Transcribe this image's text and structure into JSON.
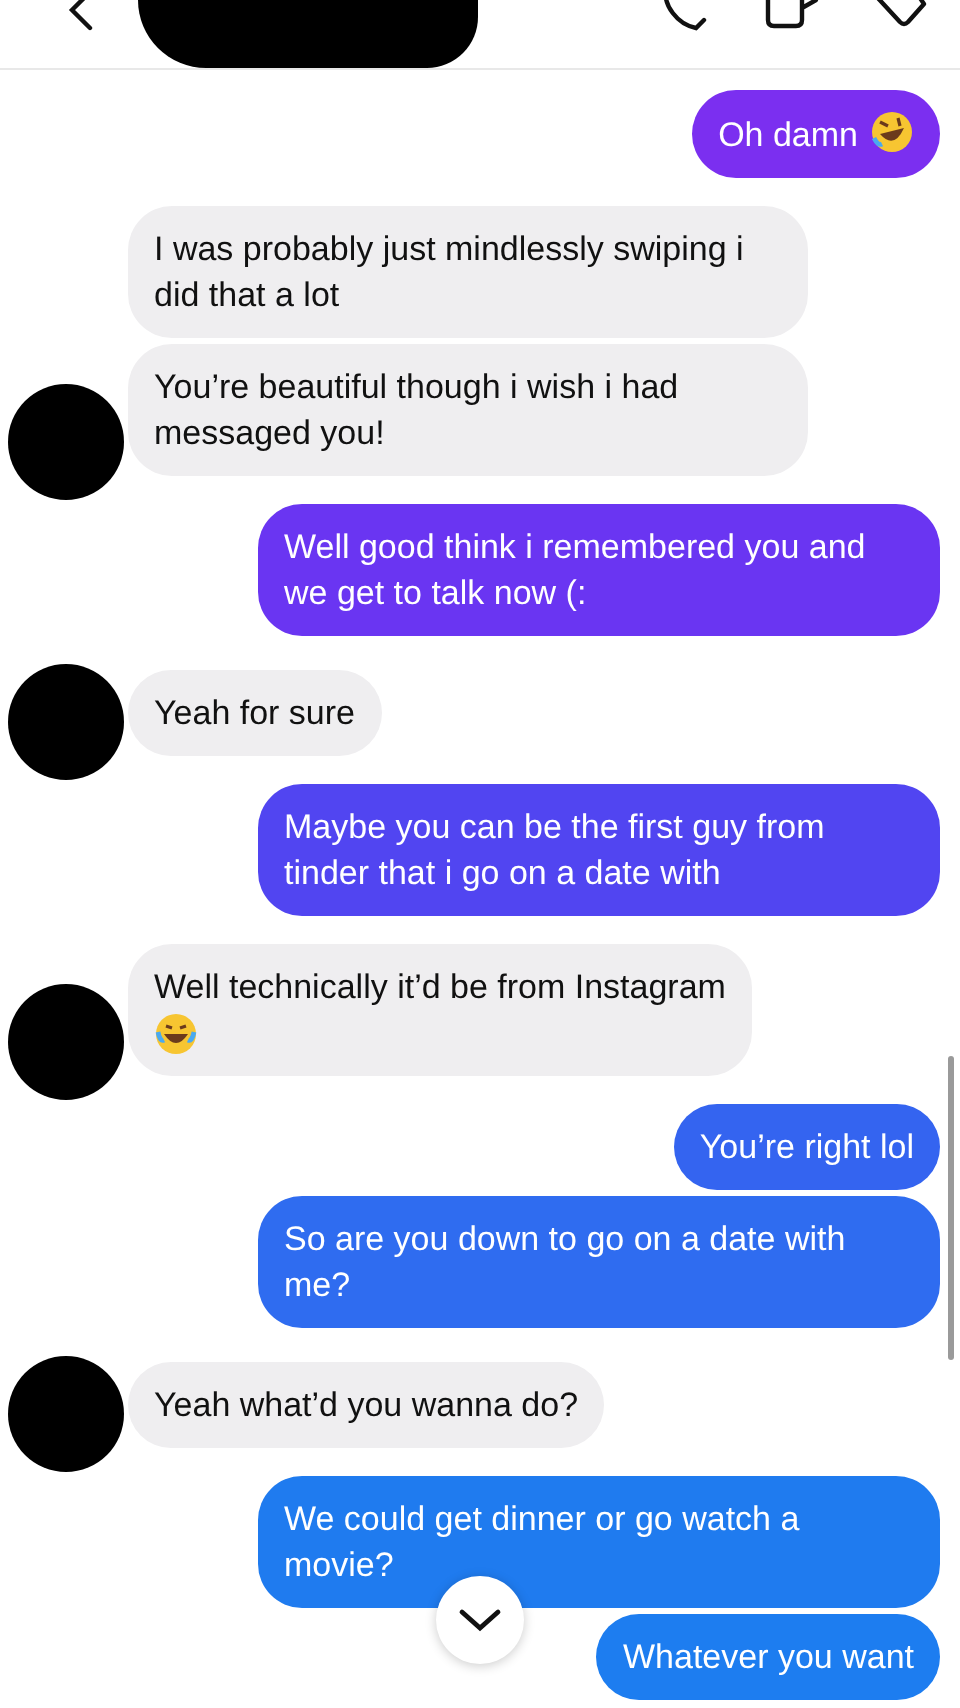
{
  "messages": [
    {
      "kind": "sent",
      "text": "Oh damn",
      "emoji": true,
      "color": "#7b2ff0"
    },
    {
      "kind": "received",
      "text": "I was probably just mindlessly swiping i did that a lot",
      "emoji": false,
      "avatar": false
    },
    {
      "kind": "received",
      "text": "You’re beautiful though i wish i had messaged you!",
      "emoji": false,
      "avatar": true
    },
    {
      "kind": "sent",
      "text": "Well good think i remembered you and we get to talk now (:",
      "emoji": false,
      "color": "#6a35f2"
    },
    {
      "kind": "received",
      "text": "Yeah for sure",
      "emoji": false,
      "avatar": true
    },
    {
      "kind": "sent",
      "text": "Maybe you can be the first guy from tinder that i go on a date with",
      "emoji": false,
      "color": "#5145f1"
    },
    {
      "kind": "received",
      "text": "Well technically it’d be from Instagram",
      "emoji": true,
      "avatar": true
    },
    {
      "kind": "sent",
      "text": "You’re right lol",
      "emoji": false,
      "color": "#3464f0"
    },
    {
      "kind": "sent",
      "text": "So are you down to go on a date with me?",
      "emoji": false,
      "color": "#2f6cf0"
    },
    {
      "kind": "received",
      "text": "Yeah what’d you wanna do?",
      "emoji": false,
      "avatar": true
    },
    {
      "kind": "sent",
      "text": "We could get dinner or go watch a movie?",
      "emoji": false,
      "color": "#1f7bef"
    },
    {
      "kind": "sent",
      "text": "Whatever you want",
      "emoji": false,
      "color": "#1d7df0"
    }
  ]
}
